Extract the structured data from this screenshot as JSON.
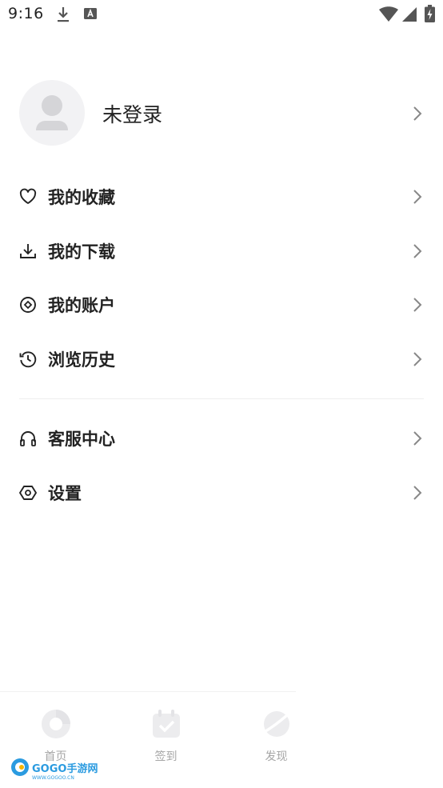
{
  "status_bar": {
    "time": "9:16",
    "icons": [
      "download-icon",
      "font-a-icon",
      "wifi-icon",
      "signal-icon",
      "battery-charging-icon"
    ]
  },
  "profile": {
    "name": "未登录",
    "avatar_icon": "user-placeholder-icon"
  },
  "menu": {
    "group1": [
      {
        "label": "我的收藏",
        "icon": "heart-icon"
      },
      {
        "label": "我的下载",
        "icon": "download-icon"
      },
      {
        "label": "我的账户",
        "icon": "account-coin-icon"
      },
      {
        "label": "浏览历史",
        "icon": "history-icon"
      }
    ],
    "group2": [
      {
        "label": "客服中心",
        "icon": "headset-icon"
      },
      {
        "label": "设置",
        "icon": "settings-hexagon-icon"
      }
    ]
  },
  "tabbar": {
    "tabs": [
      {
        "label": "首页",
        "icon": "home-icon"
      },
      {
        "label": "签到",
        "icon": "checkin-icon"
      },
      {
        "label": "发现",
        "icon": "discover-planet-icon"
      }
    ]
  },
  "watermark": {
    "brand": "GOGO手游网",
    "url": "WWW.GOGOO.CN"
  },
  "colors": {
    "text": "#222222",
    "icon_gray": "#9a9a9a",
    "tab_inactive": "#a6a6a6",
    "divider": "#eeeeee",
    "avatar_bg": "#f2f2f4"
  }
}
